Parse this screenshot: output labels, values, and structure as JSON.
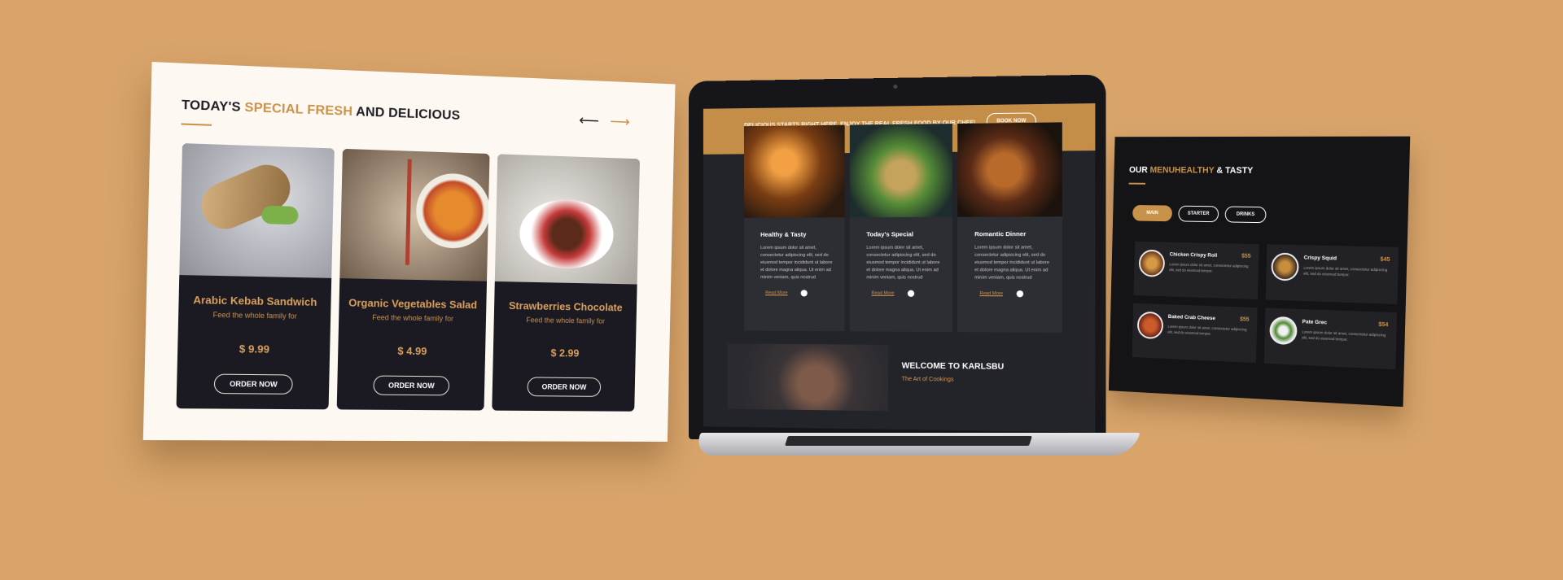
{
  "left_panel": {
    "title_part1": "TODAY'S ",
    "title_accent": "SPECIAL FRESH",
    "title_part2": " AND DELICIOUS",
    "prev_arrow": "⟵",
    "next_arrow": "⟶",
    "cards": [
      {
        "name": "Arabic Kebab Sandwich",
        "desc": "Feed the whole family for",
        "price": "$ 9.99",
        "button": "ORDER NOW"
      },
      {
        "name": "Organic Vegetables Salad",
        "desc": "Feed the whole family for",
        "price": "$ 4.99",
        "button": "ORDER NOW"
      },
      {
        "name": "Strawberries Chocolate",
        "desc": "Feed the whole family for",
        "price": "$ 2.99",
        "button": "ORDER NOW"
      }
    ]
  },
  "laptop": {
    "hero_text": "DELICIOUS STARTS RIGHT HERE. ENJOY THE REAL FRESH FOOD BY OUR CHEF!",
    "book_button": "BOOK NOW",
    "cards": [
      {
        "title": "Healthy & Tasty",
        "text": "Lorem ipsum dolor sit amet, consectetur adipiscing elit, sed do eiusmod tempor incididunt ut labore et dolore magna aliqua. Ut enim ad minim veniam, quis nostrud",
        "read_more": "Read More"
      },
      {
        "title": "Today's Special",
        "text": "Lorem ipsum dolor sit amet, consectetur adipiscing elit, sed do eiusmod tempor incididunt ut labore et dolore magna aliqua. Ut enim ad minim veniam, quis nostrud",
        "read_more": "Read More"
      },
      {
        "title": "Romantic Dinner",
        "text": "Lorem ipsum dolor sit amet, consectetur adipiscing elit, sed do eiusmod tempor incididunt ut labore et dolore magna aliqua. Ut enim ad minim veniam, quis nostrud",
        "read_more": "Read More"
      }
    ],
    "welcome_title": "WELCOME TO KARLSBU",
    "welcome_sub": "The Art of Cookings"
  },
  "right_panel": {
    "title_part1": "OUR ",
    "title_accent": "MENUHEALTHY",
    "title_part2": " & TASTY",
    "tabs": [
      "MAIN",
      "STARTER",
      "DRINKS"
    ],
    "items": [
      {
        "name": "Chicken Crispy Roll",
        "price": "$55",
        "desc": "Lorem ipsum dolor sit amet, consectetur adipiscing elit, sed do eiusmod tempor."
      },
      {
        "name": "Crispy Squid",
        "price": "$45",
        "desc": "Lorem ipsum dolor sit amet, consectetur adipiscing elit, sed do eiusmod tempor."
      },
      {
        "name": "Baked Crab Cheese",
        "price": "$55",
        "desc": "Lorem ipsum dolor sit amet, consectetur adipiscing elit, sed do eiusmod tempor."
      },
      {
        "name": "Pate Grec",
        "price": "$54",
        "desc": "Lorem ipsum dolor sit amet, consectetur adipiscing elit, sed do eiusmod tempor."
      }
    ]
  },
  "colors": {
    "background": "#d8a46a",
    "accent": "#c9924a",
    "dark": "#1b1a22"
  }
}
